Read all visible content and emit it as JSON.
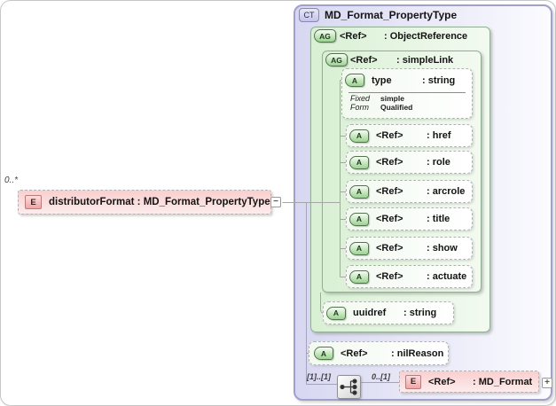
{
  "page": {
    "collapse_glyph": "−",
    "expand_glyph": "+"
  },
  "root_element": {
    "multiplicity": "0..*",
    "icon": "E",
    "label": "distributorFormat : MD_Format_PropertyType"
  },
  "complex_type": {
    "icon": "CT",
    "title": "MD_Format_PropertyType",
    "object_reference": {
      "icon": "AG",
      "name": "<Ref>",
      "type": ": ObjectReference",
      "simple_link": {
        "icon": "AG",
        "name": "<Ref>",
        "type": ": simpleLink",
        "type_attribute": {
          "icon": "A",
          "name": "type",
          "type": ": string",
          "facets": [
            {
              "label": "Fixed",
              "value": "simple"
            },
            {
              "label": "Form",
              "value": "Qualified"
            }
          ]
        },
        "attributes": [
          {
            "icon": "A",
            "name": "<Ref>",
            "type": ": href"
          },
          {
            "icon": "A",
            "name": "<Ref>",
            "type": ": role"
          },
          {
            "icon": "A",
            "name": "<Ref>",
            "type": ": arcrole"
          },
          {
            "icon": "A",
            "name": "<Ref>",
            "type": ": title"
          },
          {
            "icon": "A",
            "name": "<Ref>",
            "type": ": show"
          },
          {
            "icon": "A",
            "name": "<Ref>",
            "type": ": actuate"
          }
        ]
      },
      "uuidref_attribute": {
        "icon": "A",
        "name": "uuidref",
        "type": ": string"
      }
    },
    "nilreason_attribute": {
      "icon": "A",
      "name": "<Ref>",
      "type": ": nilReason"
    },
    "sequence": {
      "left_multiplicity": "[1]..[1]",
      "right_multiplicity": "0..[1]",
      "element": {
        "icon": "E",
        "name": "<Ref>",
        "type": ": MD_Format"
      }
    }
  }
}
